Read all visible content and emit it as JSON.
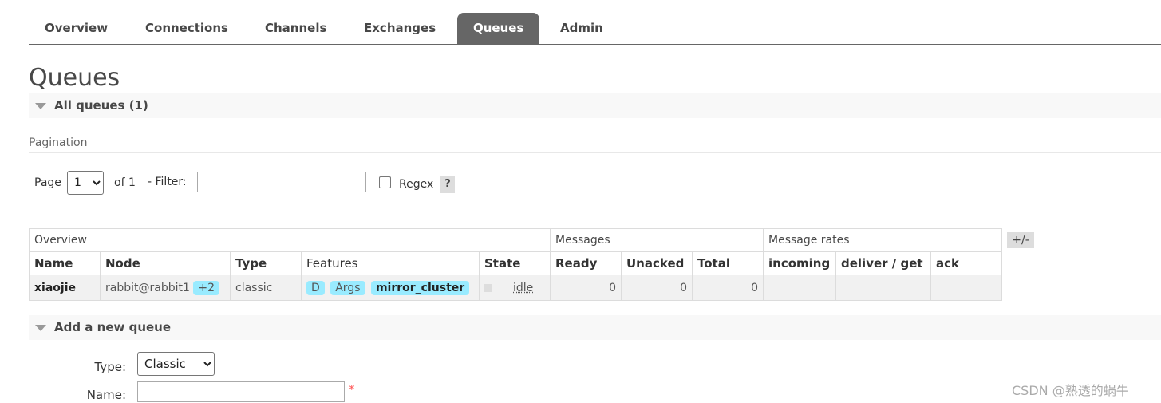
{
  "nav": {
    "tabs": [
      {
        "label": "Overview"
      },
      {
        "label": "Connections"
      },
      {
        "label": "Channels"
      },
      {
        "label": "Exchanges"
      },
      {
        "label": "Queues",
        "active": true
      },
      {
        "label": "Admin"
      }
    ]
  },
  "page": {
    "title": "Queues",
    "all_queues_label": "All queues (1)",
    "pagination_header": "Pagination",
    "page_label": "Page",
    "page_value": "1",
    "of_label": "of 1",
    "filter_label": "- Filter:",
    "filter_value": "",
    "regex_label": "Regex",
    "help_label": "?"
  },
  "table": {
    "groups": [
      "Overview",
      "Messages",
      "Message rates"
    ],
    "toggle_label": "+/-",
    "headers": [
      "Name",
      "Node",
      "Type",
      "Features",
      "State",
      "Ready",
      "Unacked",
      "Total",
      "incoming",
      "deliver / get",
      "ack"
    ],
    "rows": [
      {
        "name": "xiaojie",
        "node": "rabbit@rabbit1",
        "node_extra": "+2",
        "type": "classic",
        "features": [
          "D",
          "Args",
          "mirror_cluster"
        ],
        "state": "idle",
        "ready": "0",
        "unacked": "0",
        "total": "0",
        "incoming": "",
        "deliver_get": "",
        "ack": ""
      }
    ]
  },
  "add_queue": {
    "section_label": "Add a new queue",
    "type_label": "Type:",
    "type_value": "Classic",
    "name_label": "Name:",
    "name_value": "",
    "required_mark": "*"
  },
  "watermark": "CSDN @熟透的蜗牛",
  "colors": {
    "active_tab": "#666666",
    "feature_badge": "#99ebff",
    "section_bg": "#f8f8f8"
  }
}
